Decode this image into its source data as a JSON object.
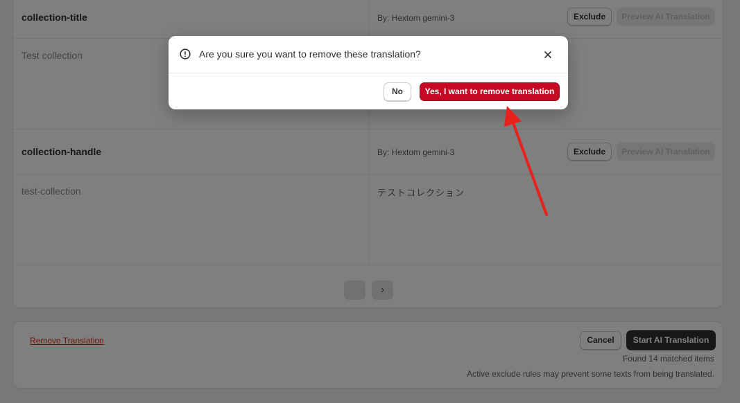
{
  "rows": [
    {
      "key": "collection-title",
      "by": "By: Hextom gemini-3",
      "exclude_label": "Exclude",
      "preview_label": "Preview AI Translation",
      "source": "Test collection",
      "target": ""
    },
    {
      "key": "collection-handle",
      "by": "By: Hextom gemini-3",
      "exclude_label": "Exclude",
      "preview_label": "Preview AI Translation",
      "source": "test-collection",
      "target": "テストコレクション"
    }
  ],
  "pagination": {
    "next_glyph": "›"
  },
  "footer": {
    "remove_link": "Remove Translation",
    "cancel_label": "Cancel",
    "start_label": "Start AI Translation",
    "matched": "Found 14 matched items",
    "note": "Active exclude rules may prevent some texts from being translated."
  },
  "modal": {
    "icon": "alert-circle-icon",
    "title": "Are you sure you want to remove these translation?",
    "no_label": "No",
    "yes_label": "Yes, I want to remove translation"
  },
  "colors": {
    "danger": "#c70a24",
    "annotation_arrow": "#e8211c",
    "primary_button": "#303030"
  }
}
